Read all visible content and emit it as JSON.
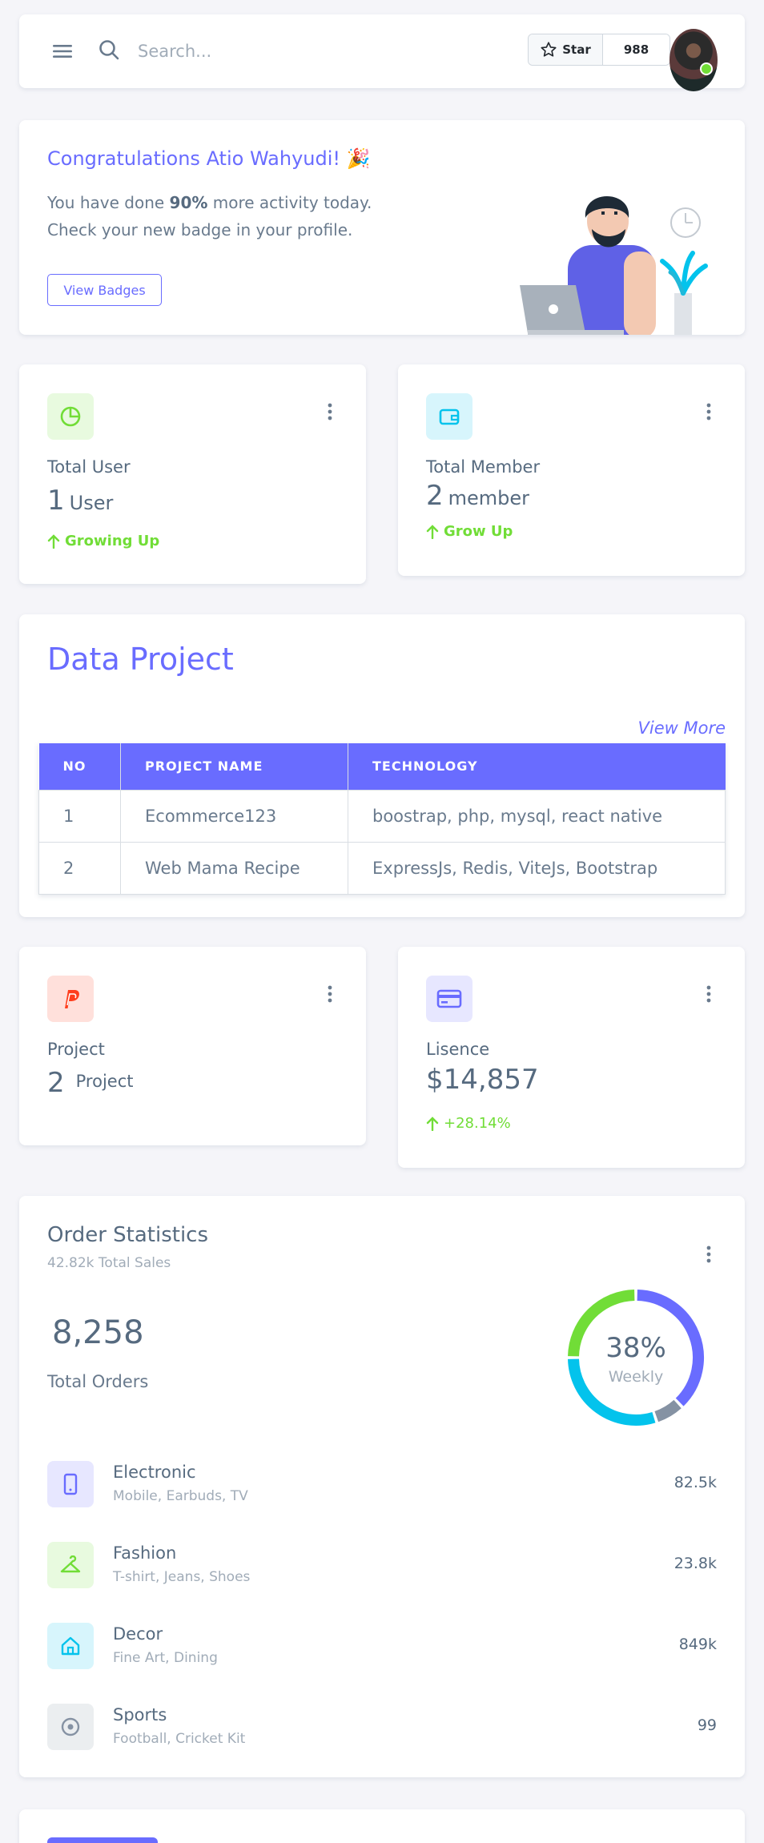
{
  "navbar": {
    "search_placeholder": "Search...",
    "github": {
      "star_label": "Star",
      "star_count": "988"
    }
  },
  "congrats": {
    "title": "Congratulations Atio Wahyudi! 🎉",
    "line1_pre": "You have done ",
    "line1_bold": "90%",
    "line1_post": " more activity today.",
    "line2": "Check your new badge in your profile.",
    "button": "View Badges"
  },
  "stats_top": [
    {
      "label": "Total User",
      "value": "1",
      "unit": "User",
      "trend": "Growing Up",
      "icon": "pie-chart-icon",
      "color": "#71dd37"
    },
    {
      "label": "Total Member",
      "value": "2",
      "unit": "member",
      "trend": "Grow Up",
      "icon": "wallet-icon",
      "color": "#03c3ec"
    }
  ],
  "data_project": {
    "title": "Data Project",
    "view_more": "View More",
    "columns": [
      "NO",
      "PROJECT NAME",
      "TECHNOLOGY"
    ],
    "rows": [
      [
        "1",
        "Ecommerce123",
        "boostrap, php, mysql, react native"
      ],
      [
        "2",
        "Web Mama Recipe",
        "ExpressJs, Redis, ViteJs, Bootstrap"
      ]
    ]
  },
  "stats_bottom": [
    {
      "label": "Project",
      "value": "2",
      "unit": "Project",
      "icon": "paypal-icon",
      "color": "#ff3e1d"
    },
    {
      "label": "Lisence",
      "value": "$14,857",
      "trend": "+28.14%",
      "icon": "credit-card-icon",
      "color": "#696cff"
    }
  ],
  "order_stats": {
    "title": "Order Statistics",
    "subtitle": "42.82k Total Sales",
    "total": "8,258",
    "total_label": "Total Orders",
    "donut_pct": "38%",
    "donut_label": "Weekly",
    "donut_segments": [
      {
        "value": 38,
        "color": "#696cff"
      },
      {
        "value": 7,
        "color": "#8592a3"
      },
      {
        "value": 30,
        "color": "#03c3ec"
      },
      {
        "value": 25,
        "color": "#71dd37"
      }
    ],
    "items": [
      {
        "name": "Electronic",
        "desc": "Mobile, Earbuds, TV",
        "value": "82.5k",
        "icon": "mobile-icon",
        "color": "#696cff",
        "bg": "#e7e7ff"
      },
      {
        "name": "Fashion",
        "desc": "T-shirt, Jeans, Shoes",
        "value": "23.8k",
        "icon": "closet-icon",
        "color": "#71dd37",
        "bg": "#e8fadf"
      },
      {
        "name": "Decor",
        "desc": "Fine Art, Dining",
        "value": "849k",
        "icon": "home-icon",
        "color": "#03c3ec",
        "bg": "#d7f5fc"
      },
      {
        "name": "Sports",
        "desc": "Football, Cricket Kit",
        "value": "99",
        "icon": "football-icon",
        "color": "#8592a3",
        "bg": "#ebeef0"
      }
    ]
  }
}
